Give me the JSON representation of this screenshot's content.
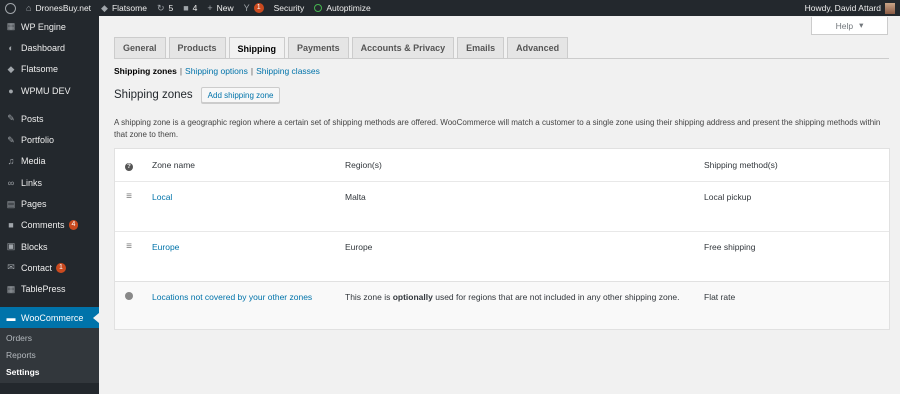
{
  "adminbar": {
    "site_name": "DronesBuy.net",
    "theme": "Flatsome",
    "updates_count": "5",
    "comments_count": "4",
    "new_label": "New",
    "yoast_badge": "1",
    "security_label": "Security",
    "autoptimize_label": "Autoptimize",
    "howdy": "Howdy, David Attard"
  },
  "sidebar": {
    "items": [
      {
        "label": "WP Engine",
        "icon": "wpengine-icon"
      },
      {
        "label": "Dashboard",
        "icon": "dashboard-icon"
      },
      {
        "label": "Flatsome",
        "icon": "flatsome-icon"
      },
      {
        "label": "WPMU DEV",
        "icon": "wpmudev-icon"
      },
      {
        "label": "Posts",
        "icon": "pin-icon"
      },
      {
        "label": "Portfolio",
        "icon": "portfolio-icon"
      },
      {
        "label": "Media",
        "icon": "media-icon"
      },
      {
        "label": "Links",
        "icon": "links-icon"
      },
      {
        "label": "Pages",
        "icon": "pages-icon"
      },
      {
        "label": "Comments",
        "icon": "comments-icon",
        "count": "4"
      },
      {
        "label": "Blocks",
        "icon": "blocks-icon"
      },
      {
        "label": "Contact",
        "icon": "contact-icon",
        "count": "1"
      },
      {
        "label": "TablePress",
        "icon": "table-icon"
      },
      {
        "label": "WooCommerce",
        "icon": "woo-icon"
      }
    ],
    "submenu": [
      "Orders",
      "Reports",
      "Settings"
    ]
  },
  "help_label": "Help",
  "tabs": [
    "General",
    "Products",
    "Shipping",
    "Payments",
    "Accounts & Privacy",
    "Emails",
    "Advanced"
  ],
  "subsub": {
    "current": "Shipping zones",
    "sep": "|",
    "options": "Shipping options",
    "classes": "Shipping classes"
  },
  "heading": {
    "title": "Shipping zones",
    "add_button": "Add shipping zone"
  },
  "description": "A shipping zone is a geographic region where a certain set of shipping methods are offered. WooCommerce will match a customer to a single zone using their shipping address and present the shipping methods within that zone to them.",
  "table": {
    "headers": {
      "name": "Zone name",
      "region": "Region(s)",
      "method": "Shipping method(s)"
    },
    "rows": [
      {
        "name": "Local",
        "region": "Malta",
        "method": "Local pickup"
      },
      {
        "name": "Europe",
        "region": "Europe",
        "method": "Free shipping"
      }
    ],
    "rest": {
      "name": "Locations not covered by your other zones",
      "region_pre": "This zone is ",
      "region_bold": "optionally",
      "region_post": " used for regions that are not included in any other shipping zone.",
      "method": "Flat rate"
    }
  }
}
